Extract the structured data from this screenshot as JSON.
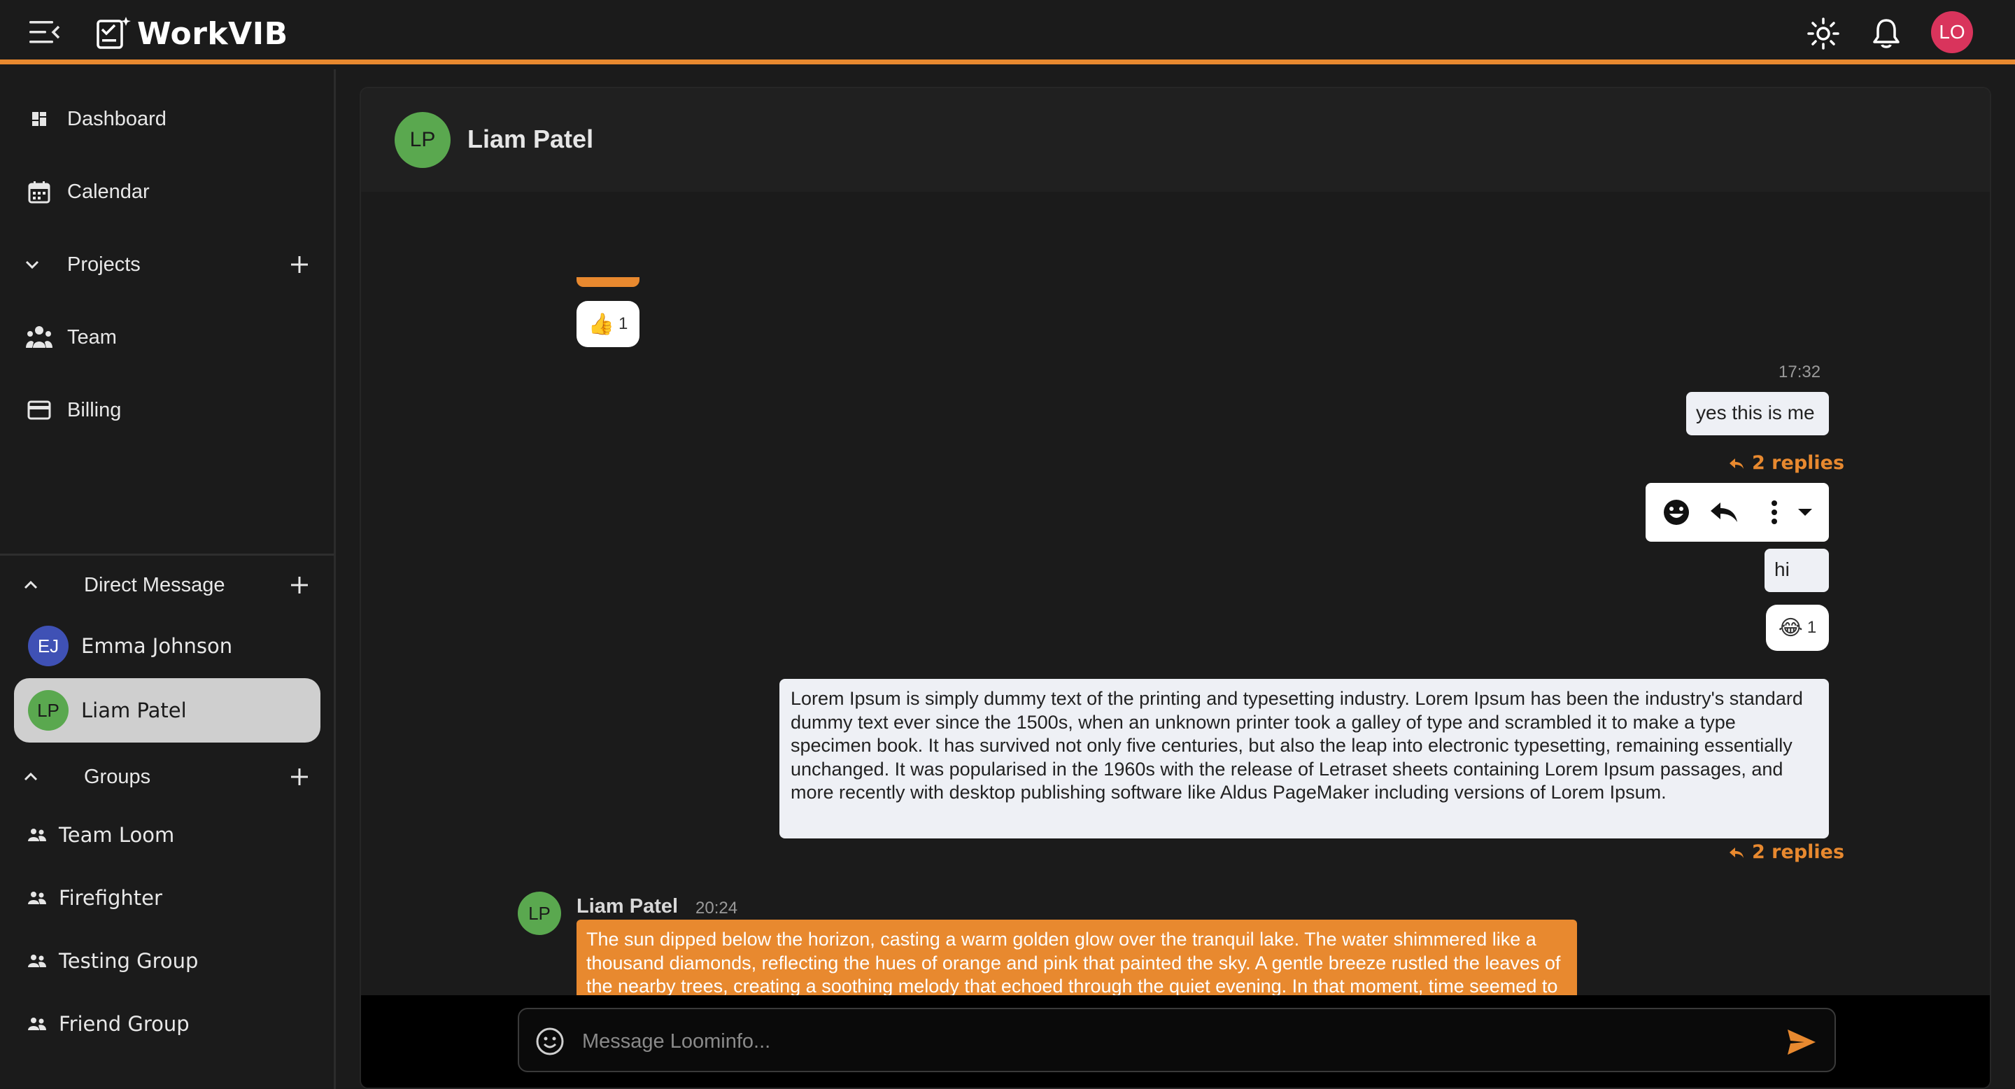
{
  "app": {
    "brand": "WorkVIB",
    "user_initials": "LO"
  },
  "colors": {
    "accent": "#e8892f",
    "background": "#1b1b1b",
    "user_avatar": "#d9345c",
    "lp_avatar": "#5aa84f",
    "ej_avatar": "#3f51b5"
  },
  "icons": {
    "menu": "menu-collapse-icon",
    "logo": "edit-note-icon",
    "theme": "sun-icon",
    "notifications": "bell-icon",
    "send": "send-icon"
  },
  "sidebar": {
    "nav": [
      {
        "label": "Dashboard",
        "icon": "dashboard-icon"
      },
      {
        "label": "Calendar",
        "icon": "calendar-icon"
      },
      {
        "label": "Projects",
        "icon": "chevron-down-icon"
      },
      {
        "label": "Team",
        "icon": "team-icon"
      },
      {
        "label": "Billing",
        "icon": "credit-card-icon"
      }
    ],
    "direct_message": {
      "title": "Direct Message",
      "items": [
        {
          "initials": "EJ",
          "name": "Emma Johnson"
        },
        {
          "initials": "LP",
          "name": "Liam Patel",
          "active": true
        }
      ]
    },
    "groups": {
      "title": "Groups",
      "items": [
        {
          "name": "Team Loom"
        },
        {
          "name": "Firefighter"
        },
        {
          "name": "Testing Group"
        },
        {
          "name": "Friend Group"
        }
      ]
    }
  },
  "chat": {
    "header": {
      "initials": "LP",
      "name": "Liam Patel"
    },
    "messages": {
      "top_reaction": {
        "emoji": "👍",
        "count": "1"
      },
      "msg1": {
        "time": "17:32",
        "text": "yes this is me",
        "replies": "2 replies"
      },
      "msg2": {
        "text": "hi",
        "reaction": {
          "emoji": "😂",
          "count": "1"
        }
      },
      "msg3": {
        "text": "Lorem Ipsum is simply dummy text of the printing and typesetting industry. Lorem Ipsum has been the industry's standard dummy text ever since the 1500s, when an unknown printer took a galley of type and scrambled it to make a type specimen book. It has survived not only five centuries, but also the leap into electronic typesetting, remaining essentially unchanged. It was popularised in the 1960s with the release of Letraset sheets containing Lorem Ipsum passages, and more recently with desktop publishing software like Aldus PageMaker including versions of Lorem Ipsum.",
        "replies": "2 replies"
      },
      "incoming": {
        "initials": "LP",
        "sender": "Liam Patel",
        "time": "20:24",
        "text": "The sun dipped below the horizon, casting a warm golden glow over the tranquil lake. The water shimmered like a thousand diamonds, reflecting the hues of orange and pink that painted the sky. A gentle breeze rustled the leaves of the nearby trees, creating a soothing melody that echoed through the quiet evening. In that moment, time seemed to stand still, inviting anyone who witnessed it to pause and appreciate the beauty of nature."
      }
    },
    "composer": {
      "placeholder": "Message Loominfo..."
    }
  }
}
